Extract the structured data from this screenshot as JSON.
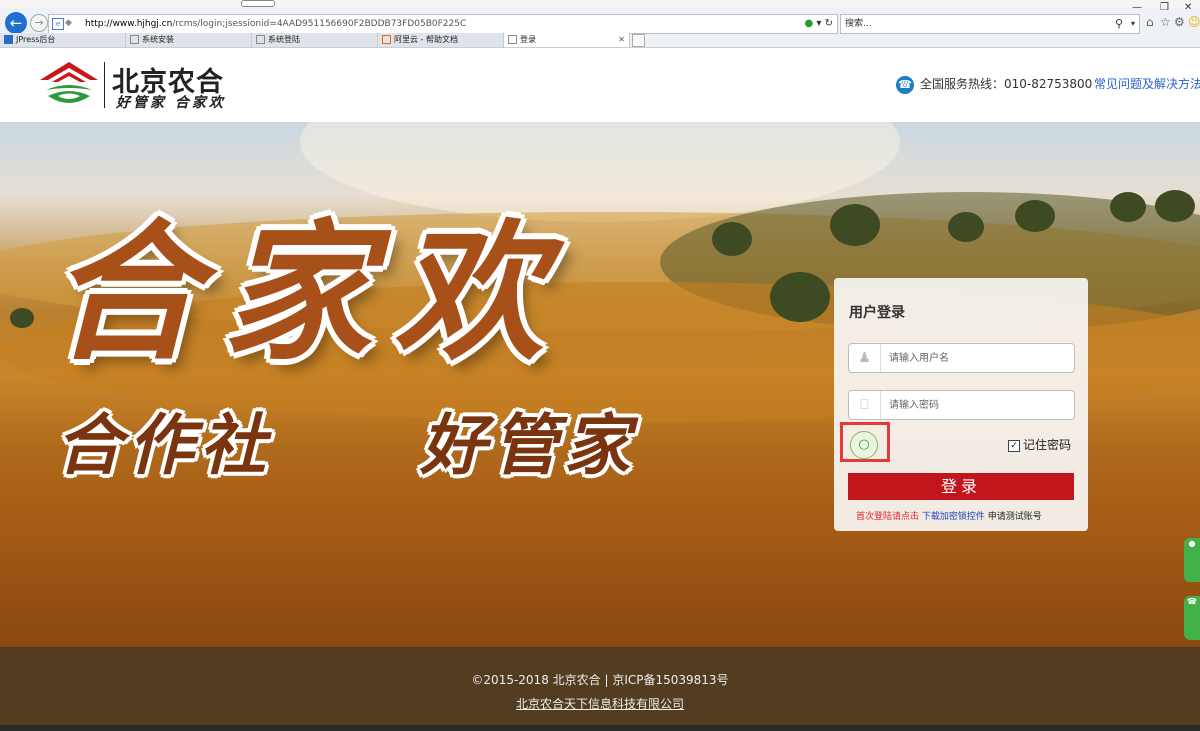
{
  "browser": {
    "url_host": "http://www.hjhgj.cn",
    "url_path": "/rcms/login;jsessionid=4AAD951156690F2BDDB73FD05B0F225C",
    "search_placeholder": "搜索...",
    "tabs": [
      {
        "label": "JPress后台",
        "icon": "jpress-icon"
      },
      {
        "label": "系统安装",
        "icon": "page-icon"
      },
      {
        "label": "系统登陆",
        "icon": "page-icon"
      },
      {
        "label": "阿里云 - 帮助文档",
        "icon": "aliyun-icon"
      },
      {
        "label": "登录",
        "icon": "page-icon",
        "active": true
      }
    ]
  },
  "header": {
    "logo_title": "北京农合",
    "logo_subtitle": "好管家 合家欢",
    "hotline_label": "全国服务热线：010-82753800",
    "faq_link": "常见问题及解决方法"
  },
  "hero": {
    "headline": "合家欢",
    "slogan_left": "合作社",
    "slogan_right": "好管家"
  },
  "login": {
    "title": "用户登录",
    "username_placeholder": "请输入用户名",
    "password_placeholder": "请输入密码",
    "remember_label": "记住密码",
    "remember_checked": true,
    "submit_label": "登录",
    "first_login_text": "首次登陆请点击",
    "download_link": "下载加密锁控件",
    "apply_link": "申请测试账号"
  },
  "footer": {
    "copyright": "©2015-2018 北京农合  |  京ICP备15039813号",
    "company": "北京农合天下信息科技有限公司"
  },
  "colors": {
    "brand_red": "#c0161c",
    "link_blue": "#2a62c9",
    "wechat_green": "#3aa017",
    "highlight_box": "#e53a3a"
  }
}
